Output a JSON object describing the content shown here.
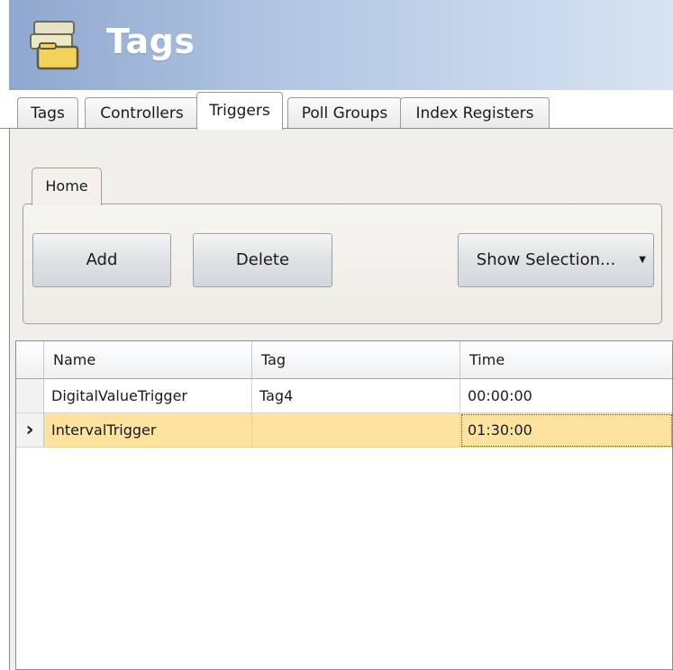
{
  "header": {
    "title": "Tags",
    "icon": "stacked-folders-icon"
  },
  "main_tabs": [
    {
      "label": "Tags",
      "active": false
    },
    {
      "label": "Controllers",
      "active": false
    },
    {
      "label": "Triggers",
      "active": true
    },
    {
      "label": "Poll Groups",
      "active": false
    },
    {
      "label": "Index Registers",
      "active": false
    }
  ],
  "ribbon": {
    "home_tab": "Home",
    "add_label": "Add",
    "delete_label": "Delete",
    "show_selection_label": "Show Selection...",
    "show_selection_caret": "▼"
  },
  "grid": {
    "columns": [
      "Name",
      "Tag",
      "Time"
    ],
    "rows": [
      {
        "name": "DigitalValueTrigger",
        "tag": "Tag4",
        "time": "00:00:00",
        "selected": false
      },
      {
        "name": "IntervalTrigger",
        "tag": "",
        "time": "01:30:00",
        "selected": true
      }
    ],
    "current_row_indicator": "›"
  },
  "colors": {
    "header_gradient_start": "#8fa8cf",
    "selected_row": "#fde39f"
  }
}
